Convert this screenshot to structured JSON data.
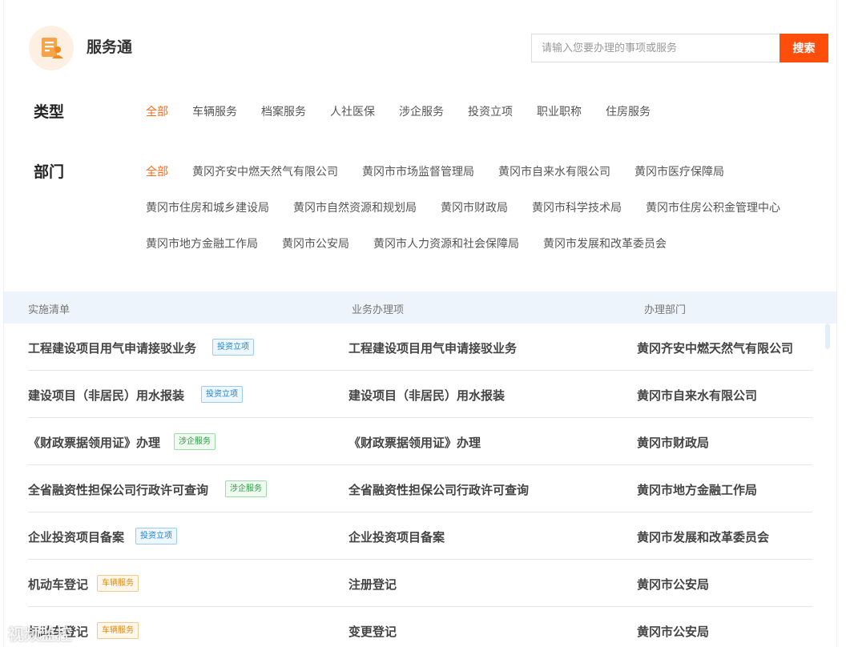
{
  "header": {
    "title": "服务通",
    "search_placeholder": "请输入您要办理的事项或服务",
    "search_button": "搜索"
  },
  "filters": {
    "type": {
      "label": "类型",
      "options": [
        "全部",
        "车辆服务",
        "档案服务",
        "人社医保",
        "涉企服务",
        "投资立项",
        "职业职称",
        "住房服务"
      ],
      "selected": "全部"
    },
    "department": {
      "label": "部门",
      "options": [
        "全部",
        "黄冈齐安中燃天然气有限公司",
        "黄冈市市场监督管理局",
        "黄冈市自来水有限公司",
        "黄冈市医疗保障局",
        "黄冈市住房和城乡建设局",
        "黄冈市自然资源和规划局",
        "黄冈市财政局",
        "黄冈市科学技术局",
        "黄冈市住房公积金管理中心",
        "黄冈市地方金融工作局",
        "黄冈市公安局",
        "黄冈市人力资源和社会保障局",
        "黄冈市发展和改革委员会"
      ],
      "selected": "全部"
    }
  },
  "table": {
    "headers": [
      "实施清单",
      "业务办理项",
      "办理部门"
    ],
    "rows": [
      {
        "name": "工程建设项目用气申请接驳业务",
        "tag": "投资立项",
        "tag_color": "blue",
        "item": "工程建设项目用气申请接驳业务",
        "dept": "黄冈齐安中燃天然气有限公司"
      },
      {
        "name": "建设项目（非居民）用水报装",
        "tag": "投资立项",
        "tag_color": "blue",
        "item": "建设项目（非居民）用水报装",
        "dept": "黄冈市自来水有限公司"
      },
      {
        "name": "《财政票据领用证》办理",
        "tag": "涉企服务",
        "tag_color": "green",
        "item": "《财政票据领用证》办理",
        "dept": "黄冈市财政局"
      },
      {
        "name": "全省融资性担保公司行政许可查询",
        "tag": "涉企服务",
        "tag_color": "green",
        "item": "全省融资性担保公司行政许可查询",
        "dept": "黄冈市地方金融工作局"
      },
      {
        "name": "企业投资项目备案",
        "tag": "投资立项",
        "tag_color": "blue",
        "item": "企业投资项目备案",
        "dept": "黄冈市发展和改革委员会"
      },
      {
        "name": "机动车登记",
        "tag": "车辆服务",
        "tag_color": "orange",
        "item": "注册登记",
        "dept": "黄冈市公安局"
      },
      {
        "name": "机动车登记",
        "tag": "车辆服务",
        "tag_color": "orange",
        "item": "变更登记",
        "dept": "黄冈市公安局"
      }
    ]
  },
  "colors": {
    "accent": "#ff4e0c",
    "active_filter": "#ff6a1a",
    "table_header_bg": "#eef4fb"
  },
  "watermark": "视频监控"
}
